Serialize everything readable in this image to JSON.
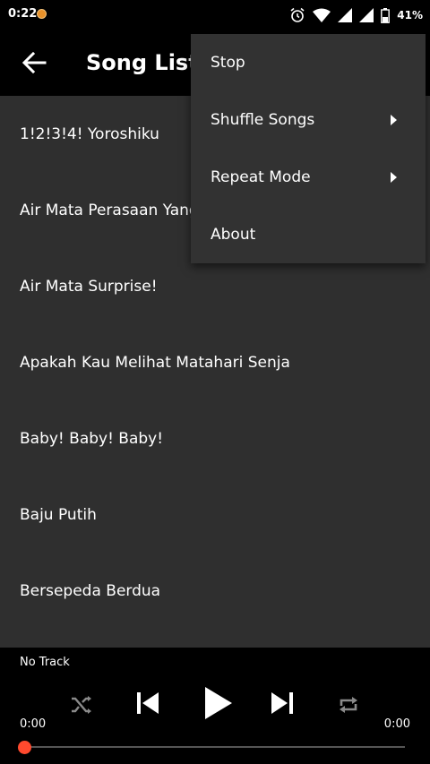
{
  "status_bar": {
    "time": "0:22",
    "battery": "41%",
    "icons": [
      "notification-icon",
      "alarm-icon",
      "wifi-icon",
      "signal-icon",
      "signal-icon",
      "battery-icon"
    ]
  },
  "app_bar": {
    "title": "Song List",
    "back_icon": "back-arrow-icon"
  },
  "songs": [
    "1!2!3!4! Yoroshiku",
    "Air Mata Perasaan Yang",
    "Air Mata Surprise!",
    "Apakah Kau Melihat Matahari Senja",
    "Baby! Baby! Baby!",
    "Baju Putih",
    "Bersepeda Berdua"
  ],
  "menu": {
    "items": [
      {
        "label": "Stop",
        "submenu": false
      },
      {
        "label": "Shuffle Songs",
        "submenu": true
      },
      {
        "label": "Repeat Mode",
        "submenu": true
      },
      {
        "label": "About",
        "submenu": false
      }
    ]
  },
  "player": {
    "track": "No Track",
    "elapsed": "0:00",
    "duration": "0:00",
    "progress": 0,
    "controls": [
      "shuffle-icon",
      "previous-icon",
      "play-icon",
      "next-icon",
      "repeat-icon"
    ],
    "accent": "#ff4a2e"
  }
}
